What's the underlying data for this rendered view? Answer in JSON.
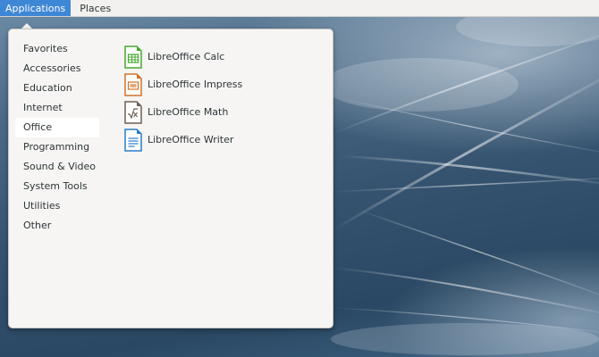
{
  "topbar": {
    "applications_label": "Applications",
    "places_label": "Places"
  },
  "menu": {
    "categories": [
      {
        "label": "Favorites"
      },
      {
        "label": "Accessories"
      },
      {
        "label": "Education"
      },
      {
        "label": "Internet"
      },
      {
        "label": "Office"
      },
      {
        "label": "Programming"
      },
      {
        "label": "Sound & Video"
      },
      {
        "label": "System Tools"
      },
      {
        "label": "Utilities"
      },
      {
        "label": "Other"
      }
    ],
    "selected_category": "Office",
    "apps": [
      {
        "label": "LibreOffice Calc",
        "icon": "libreoffice-calc-icon",
        "color": "#43a82c"
      },
      {
        "label": "LibreOffice Impress",
        "icon": "libreoffice-impress-icon",
        "color": "#d0702a"
      },
      {
        "label": "LibreOffice Math",
        "icon": "libreoffice-math-icon",
        "color": "#6f5f52"
      },
      {
        "label": "LibreOffice Writer",
        "icon": "libreoffice-writer-icon",
        "color": "#2a7dc6"
      }
    ]
  },
  "colors": {
    "accent": "#3e87d6",
    "panel": "#f2f1ef",
    "menu_bg": "#f6f5f4"
  }
}
